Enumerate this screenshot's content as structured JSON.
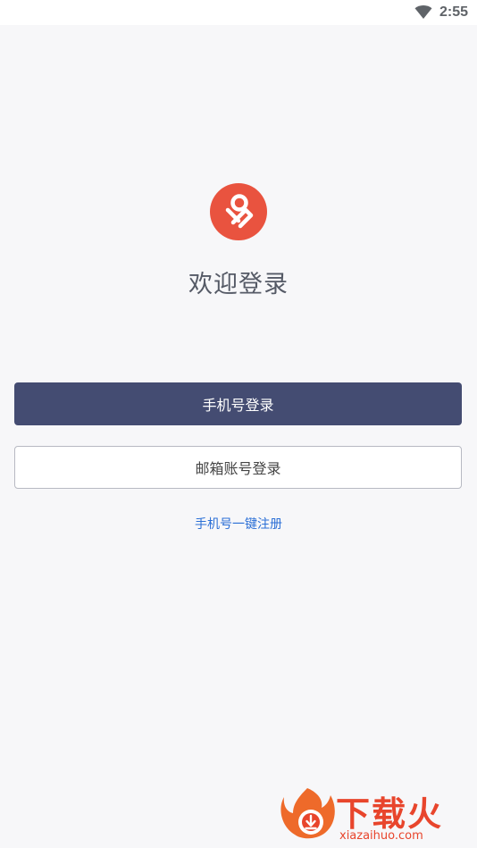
{
  "status_bar": {
    "time": "2:55",
    "wifi_icon": "wifi-icon"
  },
  "brand": {
    "logo_icon": "app-logo-icon",
    "logo_color": "#e9533f"
  },
  "welcome_title": "欢迎登录",
  "buttons": {
    "phone_login": "手机号登录",
    "email_login": "邮箱账号登录"
  },
  "register_link": "手机号一键注册",
  "watermark": {
    "brand": "下载火",
    "url": "xiazaihuo.com",
    "icon": "flame-download-icon"
  },
  "colors": {
    "primary_button": "#444c72",
    "link": "#2b6fd6",
    "background": "#f7f7f9",
    "watermark": "#e8452c"
  }
}
